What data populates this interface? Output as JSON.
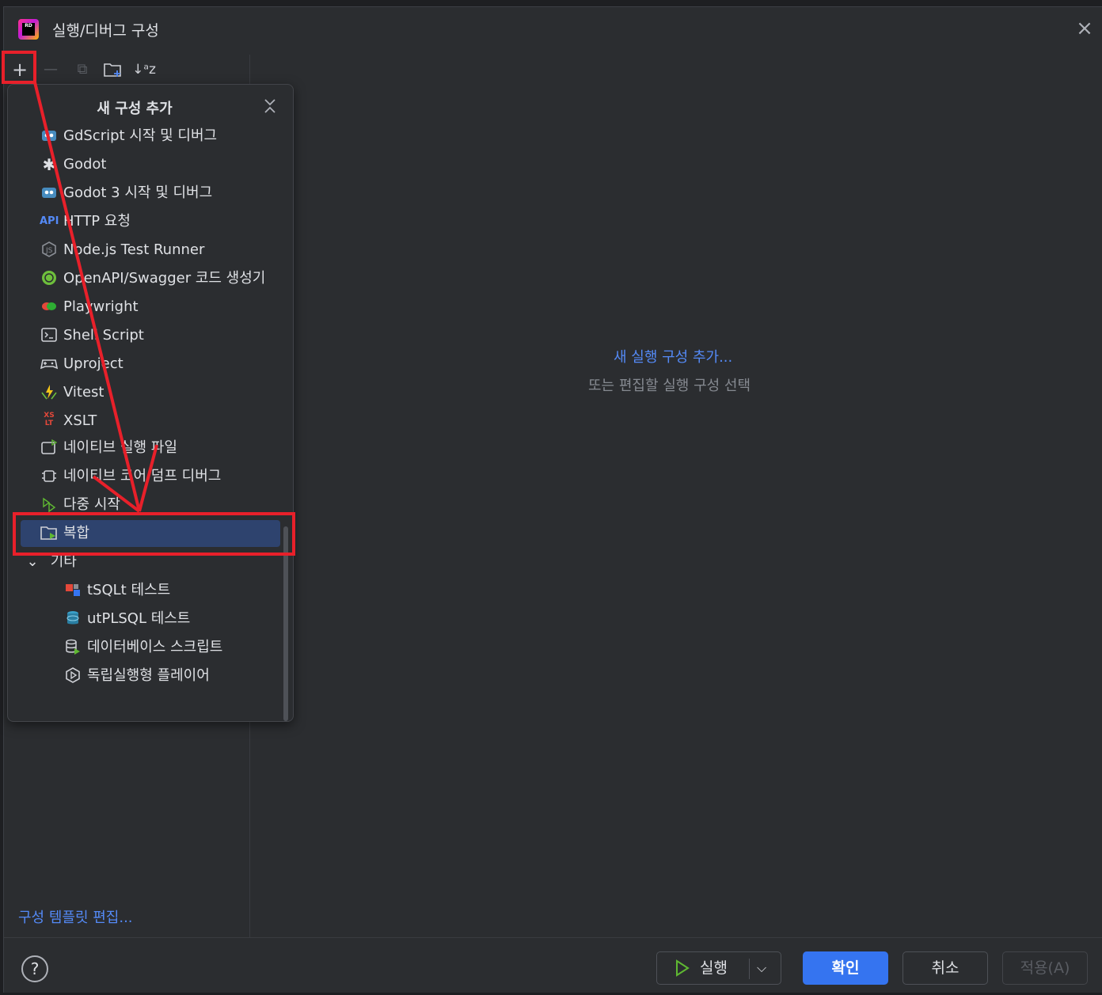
{
  "window": {
    "title": "실행/디버그 구성",
    "logo_text": "RD"
  },
  "toolbar": {
    "add": "+",
    "remove": "—",
    "copy": "⧉",
    "folder": "📁",
    "sort": "↓ᵃz"
  },
  "popup": {
    "title": "새 구성 추가",
    "items": [
      {
        "label": "GdScript 시작 및 디버그",
        "icon": "godot-icon",
        "color": "#478cbf"
      },
      {
        "label": "Godot",
        "icon": "gear-icon",
        "color": "#dfe1e5"
      },
      {
        "label": "Godot 3 시작 및 디버그",
        "icon": "godot-icon",
        "color": "#478cbf"
      },
      {
        "label": "HTTP 요청",
        "icon": "api-icon",
        "color": "#548af7"
      },
      {
        "label": "Node.js Test Runner",
        "icon": "nodejs-icon",
        "color": "#8a8e95"
      },
      {
        "label": "OpenAPI/Swagger 코드 생성기",
        "icon": "swagger-icon",
        "color": "#6ebf3c"
      },
      {
        "label": "Playwright",
        "icon": "playwright-icon",
        "color": "#e4483a"
      },
      {
        "label": "Shell Script",
        "icon": "terminal-icon",
        "color": "#ced0d6"
      },
      {
        "label": "Uproject",
        "icon": "gamepad-icon",
        "color": "#ced0d6"
      },
      {
        "label": "Vitest",
        "icon": "vitest-icon",
        "color": "#f5c518"
      },
      {
        "label": "XSLT",
        "icon": "xslt-icon",
        "color": "#e4483a"
      },
      {
        "label": "네이티브 실행 파일",
        "icon": "native-exe-icon",
        "color": "#ced0d6"
      },
      {
        "label": "네이티브 코어 덤프 디버그",
        "icon": "core-dump-icon",
        "color": "#ced0d6"
      },
      {
        "label": "다중 시작",
        "icon": "multi-launch-icon",
        "color": "#5fb832"
      }
    ],
    "selected": {
      "label": "복합",
      "icon": "compound-folder-icon"
    },
    "group": {
      "label": "기타",
      "chevron": "⌄"
    },
    "sub_items": [
      {
        "label": "tSQLt 테스트",
        "icon": "tsqlt-icon"
      },
      {
        "label": "utPLSQL 테스트",
        "icon": "utplsql-icon"
      },
      {
        "label": "데이터베이스 스크립트",
        "icon": "database-script-icon"
      },
      {
        "label": "독립실행형 플레이어",
        "icon": "standalone-player-icon"
      }
    ]
  },
  "main": {
    "add_link": "새 실행 구성 추가...",
    "hint": "또는 편집할 실행 구성 선택"
  },
  "footer": {
    "templates_link": "구성 템플릿 편집...",
    "help": "?",
    "run": "실행",
    "ok": "확인",
    "cancel": "취소",
    "apply": "적용(A)"
  },
  "colors": {
    "accent": "#3574f0",
    "link": "#548af7",
    "annotation": "#e8202a",
    "selection": "#2e436e"
  }
}
